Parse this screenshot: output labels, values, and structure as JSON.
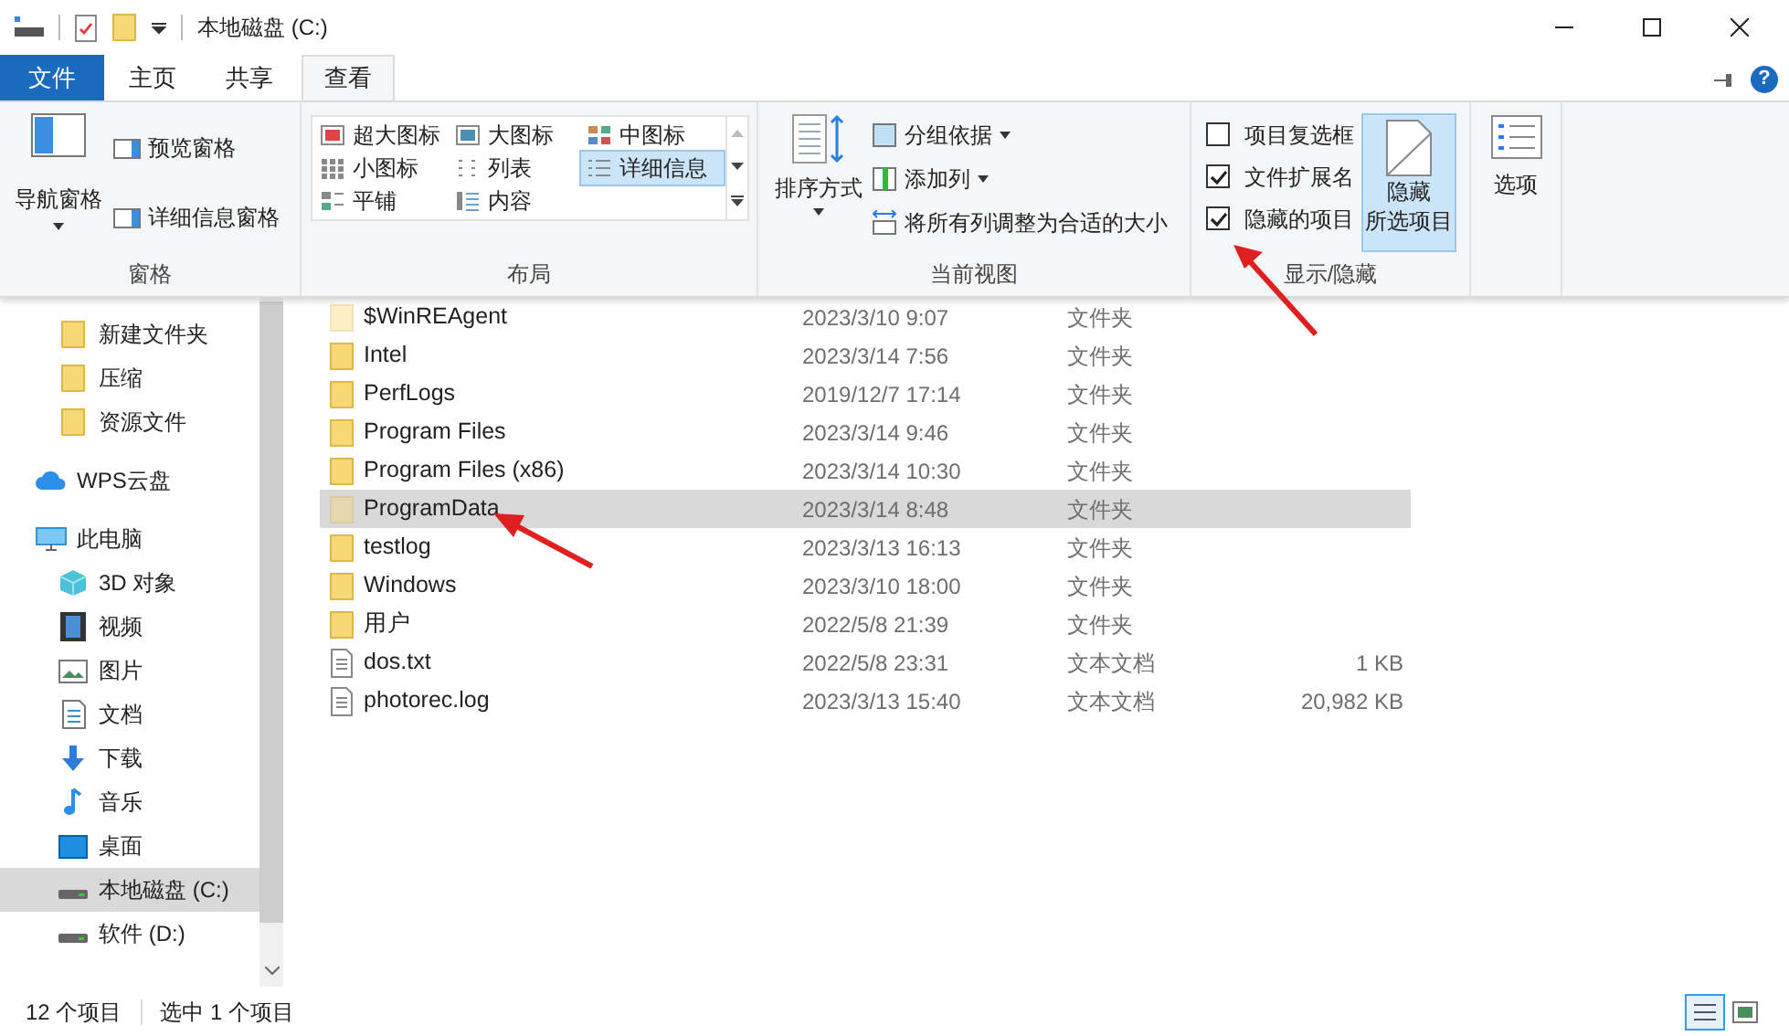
{
  "window": {
    "title": "本地磁盘 (C:)",
    "help": "?"
  },
  "tabs": [
    {
      "label": "文件",
      "kind": "file",
      "selected": false
    },
    {
      "label": "主页",
      "kind": "tab",
      "selected": false
    },
    {
      "label": "共享",
      "kind": "tab",
      "selected": false
    },
    {
      "label": "查看",
      "kind": "tab",
      "selected": true
    }
  ],
  "ribbon": {
    "panes": {
      "label": "窗格",
      "nav_pane": "导航窗格",
      "preview_pane": "预览窗格",
      "details_pane": "详细信息窗格"
    },
    "layout": {
      "label": "布局",
      "options": [
        {
          "label": "超大图标",
          "selected": false
        },
        {
          "label": "大图标",
          "selected": false
        },
        {
          "label": "中图标",
          "selected": false
        },
        {
          "label": "小图标",
          "selected": false
        },
        {
          "label": "列表",
          "selected": false
        },
        {
          "label": "详细信息",
          "selected": true
        },
        {
          "label": "平铺",
          "selected": false
        },
        {
          "label": "内容",
          "selected": false
        }
      ]
    },
    "current_view": {
      "label": "当前视图",
      "sort": "排序方式",
      "group_by": "分组依据",
      "add_column": "添加列",
      "fit_columns": "将所有列调整为合适的大小"
    },
    "show_hide": {
      "label": "显示/隐藏",
      "checkboxes": [
        {
          "label": "项目复选框",
          "checked": false
        },
        {
          "label": "文件扩展名",
          "checked": true
        },
        {
          "label": "隐藏的项目",
          "checked": true
        }
      ],
      "hide_selected": [
        "隐藏",
        "所选项目"
      ]
    },
    "options": {
      "label": "选项"
    }
  },
  "sidebar": {
    "items": [
      {
        "label": "新建文件夹",
        "kind": "folder",
        "selected": false
      },
      {
        "label": "压缩",
        "kind": "folder",
        "selected": false
      },
      {
        "label": "资源文件",
        "kind": "folder",
        "selected": false
      },
      {
        "label": "WPS云盘",
        "kind": "cloud",
        "selected": false
      },
      {
        "label": "此电脑",
        "kind": "pc",
        "selected": false
      },
      {
        "label": "3D 对象",
        "kind": "cube",
        "selected": false
      },
      {
        "label": "视频",
        "kind": "video",
        "selected": false
      },
      {
        "label": "图片",
        "kind": "picture",
        "selected": false
      },
      {
        "label": "文档",
        "kind": "document",
        "selected": false
      },
      {
        "label": "下载",
        "kind": "download",
        "selected": false
      },
      {
        "label": "音乐",
        "kind": "music",
        "selected": false
      },
      {
        "label": "桌面",
        "kind": "desktop",
        "selected": false
      },
      {
        "label": "本地磁盘 (C:)",
        "kind": "drive",
        "selected": true
      },
      {
        "label": "软件 (D:)",
        "kind": "drive",
        "selected": false
      }
    ]
  },
  "files": [
    {
      "name": "$WinREAgent",
      "date": "2023/3/10 9:07",
      "type": "文件夹",
      "kind": "folder",
      "hidden": true,
      "selected": false
    },
    {
      "name": "Intel",
      "date": "2023/3/14 7:56",
      "type": "文件夹",
      "kind": "folder",
      "hidden": false,
      "selected": false
    },
    {
      "name": "PerfLogs",
      "date": "2019/12/7 17:14",
      "type": "文件夹",
      "kind": "folder",
      "hidden": false,
      "selected": false
    },
    {
      "name": "Program Files",
      "date": "2023/3/14 9:46",
      "type": "文件夹",
      "kind": "folder",
      "hidden": false,
      "selected": false
    },
    {
      "name": "Program Files (x86)",
      "date": "2023/3/14 10:30",
      "type": "文件夹",
      "kind": "folder",
      "hidden": false,
      "selected": false
    },
    {
      "name": "ProgramData",
      "date": "2023/3/14 8:48",
      "type": "文件夹",
      "kind": "folder",
      "hidden": true,
      "selected": true
    },
    {
      "name": "testlog",
      "date": "2023/3/13 16:13",
      "type": "文件夹",
      "kind": "folder",
      "hidden": false,
      "selected": false
    },
    {
      "name": "Windows",
      "date": "2023/3/10 18:00",
      "type": "文件夹",
      "kind": "folder",
      "hidden": false,
      "selected": false
    },
    {
      "name": "用户",
      "date": "2022/5/8 21:39",
      "type": "文件夹",
      "kind": "folder",
      "hidden": false,
      "selected": false
    },
    {
      "name": "dos.txt",
      "date": "2022/5/8 23:31",
      "type": "文本文档",
      "size": "1 KB",
      "kind": "file",
      "hidden": false,
      "selected": false
    },
    {
      "name": "photorec.log",
      "date": "2023/3/13 15:40",
      "type": "文本文档",
      "size": "20,982 KB",
      "kind": "file",
      "hidden": false,
      "selected": false
    }
  ],
  "status_bar": {
    "count": "12 个项目",
    "selection": "选中 1 个项目",
    "view_toggles": [
      {
        "selected": true
      },
      {
        "selected": false
      }
    ]
  }
}
